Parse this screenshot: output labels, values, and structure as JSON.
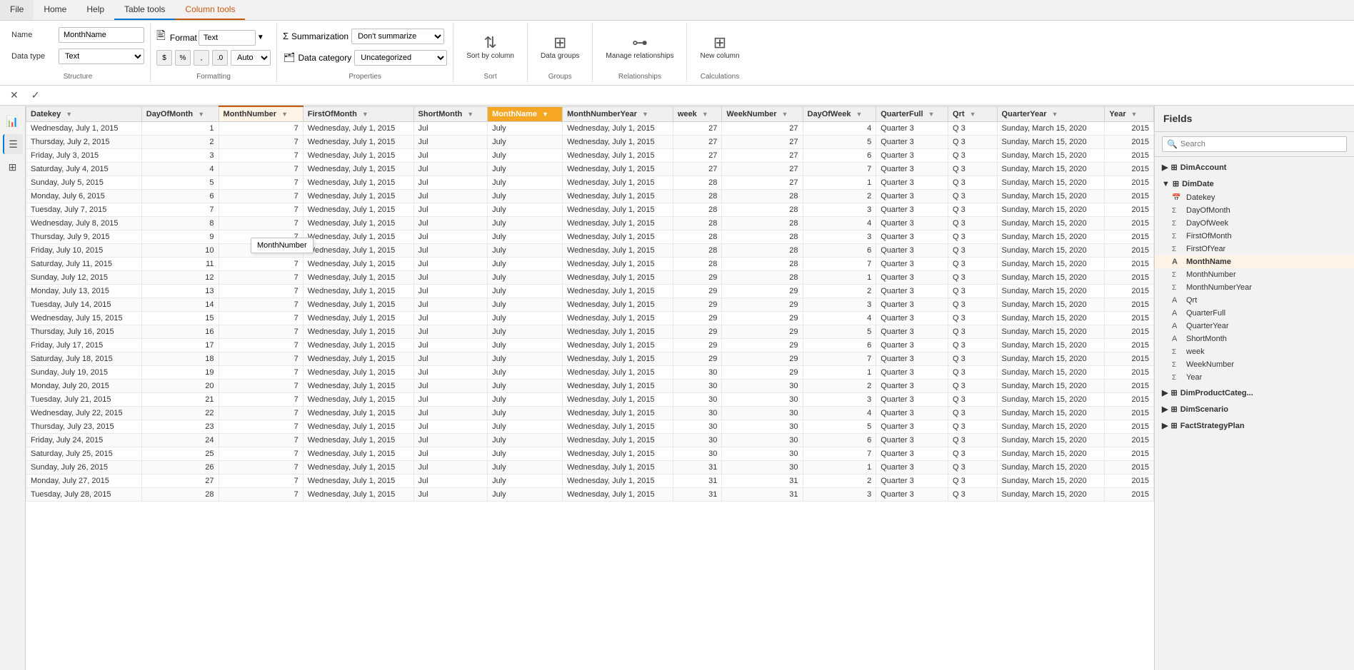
{
  "ribbon": {
    "tabs": [
      "File",
      "Home",
      "Help",
      "Table tools",
      "Column tools"
    ],
    "active_tab": "Column tools",
    "active_secondary": "Table tools",
    "structure_group": "Structure",
    "formatting_group": "Formatting",
    "properties_group": "Properties",
    "sort_group": "Sort",
    "groups_group": "Groups",
    "relationships_group": "Relationships",
    "calculations_group": "Calculations",
    "name_label": "Name",
    "name_value": "MonthName",
    "data_type_label": "Data type",
    "data_type_value": "Text",
    "format_label": "Format",
    "format_value": "Text",
    "summarization_label": "Summarization",
    "summarization_value": "Don't summarize",
    "data_category_label": "Data category",
    "data_category_value": "Uncategorized",
    "sort_by_column_label": "Sort by\ncolumn",
    "data_groups_label": "Data\ngroups",
    "manage_relationships_label": "Manage\nrelationships",
    "new_column_label": "New\ncolumn",
    "currency_symbol": "$",
    "percent_symbol": "%",
    "comma_symbol": ",",
    "decimal_symbol": ".0",
    "auto_label": "Auto"
  },
  "toolbar": {
    "close_label": "✕",
    "confirm_label": "✓"
  },
  "fields_panel": {
    "title": "Fields",
    "search_placeholder": "Search",
    "groups": [
      {
        "name": "DimAccount",
        "expanded": false,
        "icon": "table"
      },
      {
        "name": "DimDate",
        "expanded": true,
        "icon": "table",
        "fields": [
          {
            "name": "Datekey",
            "type": "calendar"
          },
          {
            "name": "DayOfMonth",
            "type": "sigma"
          },
          {
            "name": "DayOfWeek",
            "type": "sigma"
          },
          {
            "name": "FirstOfMonth",
            "type": "sigma"
          },
          {
            "name": "FirstOfYear",
            "type": "sigma"
          },
          {
            "name": "MonthName",
            "type": "text",
            "active": true
          },
          {
            "name": "MonthNumber",
            "type": "sigma"
          },
          {
            "name": "MonthNumberYear",
            "type": "sigma"
          },
          {
            "name": "Qrt",
            "type": "text"
          },
          {
            "name": "QuarterFull",
            "type": "text"
          },
          {
            "name": "QuarterYear",
            "type": "text"
          },
          {
            "name": "ShortMonth",
            "type": "text"
          },
          {
            "name": "week",
            "type": "sigma"
          },
          {
            "name": "WeekNumber",
            "type": "sigma"
          },
          {
            "name": "Year",
            "type": "sigma"
          }
        ]
      },
      {
        "name": "DimProductCateg...",
        "expanded": false,
        "icon": "table"
      },
      {
        "name": "DimScenario",
        "expanded": false,
        "icon": "table"
      },
      {
        "name": "FactStrategyPlan",
        "expanded": false,
        "icon": "table"
      }
    ]
  },
  "table": {
    "columns": [
      "Datekey",
      "DayOfMonth",
      "MonthNumber",
      "FirstOfMonth",
      "ShortMonth",
      "MonthName",
      "MonthNumberYear",
      "week",
      "WeekNumber",
      "DayOfWeek",
      "QuarterFull",
      "Qrt",
      "QuarterYear",
      "Year"
    ],
    "active_column": "MonthNumber",
    "highlighted_column": "MonthName",
    "rows": [
      [
        "Wednesday, July 1, 2015",
        "1",
        "7",
        "Wednesday, July 1, 2015",
        "Jul",
        "July",
        "Wednesday, July 1, 2015",
        "27",
        "27",
        "4",
        "Quarter 3",
        "Q 3",
        "Sunday, March 15, 2020",
        "2015"
      ],
      [
        "Thursday, July 2, 2015",
        "2",
        "7",
        "Wednesday, July 1, 2015",
        "Jul",
        "July",
        "Wednesday, July 1, 2015",
        "27",
        "27",
        "5",
        "Quarter 3",
        "Q 3",
        "Sunday, March 15, 2020",
        "2015"
      ],
      [
        "Friday, July 3, 2015",
        "3",
        "7",
        "Wednesday, July 1, 2015",
        "Jul",
        "July",
        "Wednesday, July 1, 2015",
        "27",
        "27",
        "6",
        "Quarter 3",
        "Q 3",
        "Sunday, March 15, 2020",
        "2015"
      ],
      [
        "Saturday, July 4, 2015",
        "4",
        "7",
        "Wednesday, July 1, 2015",
        "Jul",
        "July",
        "Wednesday, July 1, 2015",
        "27",
        "27",
        "7",
        "Quarter 3",
        "Q 3",
        "Sunday, March 15, 2020",
        "2015"
      ],
      [
        "Sunday, July 5, 2015",
        "5",
        "7",
        "Wednesday, July 1, 2015",
        "Jul",
        "July",
        "Wednesday, July 1, 2015",
        "28",
        "27",
        "1",
        "Quarter 3",
        "Q 3",
        "Sunday, March 15, 2020",
        "2015"
      ],
      [
        "Monday, July 6, 2015",
        "6",
        "7",
        "Wednesday, July 1, 2015",
        "Jul",
        "July",
        "Wednesday, July 1, 2015",
        "28",
        "28",
        "2",
        "Quarter 3",
        "Q 3",
        "Sunday, March 15, 2020",
        "2015"
      ],
      [
        "Tuesday, July 7, 2015",
        "7",
        "7",
        "Wednesday, July 1, 2015",
        "Jul",
        "July",
        "Wednesday, July 1, 2015",
        "28",
        "28",
        "3",
        "Quarter 3",
        "Q 3",
        "Sunday, March 15, 2020",
        "2015"
      ],
      [
        "Wednesday, July 8, 2015",
        "8",
        "7",
        "Wednesday, July 1, 2015",
        "Jul",
        "July",
        "Wednesday, July 1, 2015",
        "28",
        "28",
        "4",
        "Quarter 3",
        "Q 3",
        "Sunday, March 15, 2020",
        "2015"
      ],
      [
        "Thursday, July 9, 2015",
        "9",
        "7",
        "Wednesday, July 1, 2015",
        "Jul",
        "July",
        "Wednesday, July 1, 2015",
        "28",
        "28",
        "3",
        "Quarter 3",
        "Q 3",
        "Sunday, March 15, 2020",
        "2015"
      ],
      [
        "Friday, July 10, 2015",
        "10",
        "7",
        "Wednesday, July 1, 2015",
        "Jul",
        "July",
        "Wednesday, July 1, 2015",
        "28",
        "28",
        "6",
        "Quarter 3",
        "Q 3",
        "Sunday, March 15, 2020",
        "2015"
      ],
      [
        "Saturday, July 11, 2015",
        "11",
        "7",
        "Wednesday, July 1, 2015",
        "Jul",
        "July",
        "Wednesday, July 1, 2015",
        "28",
        "28",
        "7",
        "Quarter 3",
        "Q 3",
        "Sunday, March 15, 2020",
        "2015"
      ],
      [
        "Sunday, July 12, 2015",
        "12",
        "7",
        "Wednesday, July 1, 2015",
        "Jul",
        "July",
        "Wednesday, July 1, 2015",
        "29",
        "28",
        "1",
        "Quarter 3",
        "Q 3",
        "Sunday, March 15, 2020",
        "2015"
      ],
      [
        "Monday, July 13, 2015",
        "13",
        "7",
        "Wednesday, July 1, 2015",
        "Jul",
        "July",
        "Wednesday, July 1, 2015",
        "29",
        "29",
        "2",
        "Quarter 3",
        "Q 3",
        "Sunday, March 15, 2020",
        "2015"
      ],
      [
        "Tuesday, July 14, 2015",
        "14",
        "7",
        "Wednesday, July 1, 2015",
        "Jul",
        "July",
        "Wednesday, July 1, 2015",
        "29",
        "29",
        "3",
        "Quarter 3",
        "Q 3",
        "Sunday, March 15, 2020",
        "2015"
      ],
      [
        "Wednesday, July 15, 2015",
        "15",
        "7",
        "Wednesday, July 1, 2015",
        "Jul",
        "July",
        "Wednesday, July 1, 2015",
        "29",
        "29",
        "4",
        "Quarter 3",
        "Q 3",
        "Sunday, March 15, 2020",
        "2015"
      ],
      [
        "Thursday, July 16, 2015",
        "16",
        "7",
        "Wednesday, July 1, 2015",
        "Jul",
        "July",
        "Wednesday, July 1, 2015",
        "29",
        "29",
        "5",
        "Quarter 3",
        "Q 3",
        "Sunday, March 15, 2020",
        "2015"
      ],
      [
        "Friday, July 17, 2015",
        "17",
        "7",
        "Wednesday, July 1, 2015",
        "Jul",
        "July",
        "Wednesday, July 1, 2015",
        "29",
        "29",
        "6",
        "Quarter 3",
        "Q 3",
        "Sunday, March 15, 2020",
        "2015"
      ],
      [
        "Saturday, July 18, 2015",
        "18",
        "7",
        "Wednesday, July 1, 2015",
        "Jul",
        "July",
        "Wednesday, July 1, 2015",
        "29",
        "29",
        "7",
        "Quarter 3",
        "Q 3",
        "Sunday, March 15, 2020",
        "2015"
      ],
      [
        "Sunday, July 19, 2015",
        "19",
        "7",
        "Wednesday, July 1, 2015",
        "Jul",
        "July",
        "Wednesday, July 1, 2015",
        "30",
        "29",
        "1",
        "Quarter 3",
        "Q 3",
        "Sunday, March 15, 2020",
        "2015"
      ],
      [
        "Monday, July 20, 2015",
        "20",
        "7",
        "Wednesday, July 1, 2015",
        "Jul",
        "July",
        "Wednesday, July 1, 2015",
        "30",
        "30",
        "2",
        "Quarter 3",
        "Q 3",
        "Sunday, March 15, 2020",
        "2015"
      ],
      [
        "Tuesday, July 21, 2015",
        "21",
        "7",
        "Wednesday, July 1, 2015",
        "Jul",
        "July",
        "Wednesday, July 1, 2015",
        "30",
        "30",
        "3",
        "Quarter 3",
        "Q 3",
        "Sunday, March 15, 2020",
        "2015"
      ],
      [
        "Wednesday, July 22, 2015",
        "22",
        "7",
        "Wednesday, July 1, 2015",
        "Jul",
        "July",
        "Wednesday, July 1, 2015",
        "30",
        "30",
        "4",
        "Quarter 3",
        "Q 3",
        "Sunday, March 15, 2020",
        "2015"
      ],
      [
        "Thursday, July 23, 2015",
        "23",
        "7",
        "Wednesday, July 1, 2015",
        "Jul",
        "July",
        "Wednesday, July 1, 2015",
        "30",
        "30",
        "5",
        "Quarter 3",
        "Q 3",
        "Sunday, March 15, 2020",
        "2015"
      ],
      [
        "Friday, July 24, 2015",
        "24",
        "7",
        "Wednesday, July 1, 2015",
        "Jul",
        "July",
        "Wednesday, July 1, 2015",
        "30",
        "30",
        "6",
        "Quarter 3",
        "Q 3",
        "Sunday, March 15, 2020",
        "2015"
      ],
      [
        "Saturday, July 25, 2015",
        "25",
        "7",
        "Wednesday, July 1, 2015",
        "Jul",
        "July",
        "Wednesday, July 1, 2015",
        "30",
        "30",
        "7",
        "Quarter 3",
        "Q 3",
        "Sunday, March 15, 2020",
        "2015"
      ],
      [
        "Sunday, July 26, 2015",
        "26",
        "7",
        "Wednesday, July 1, 2015",
        "Jul",
        "July",
        "Wednesday, July 1, 2015",
        "31",
        "30",
        "1",
        "Quarter 3",
        "Q 3",
        "Sunday, March 15, 2020",
        "2015"
      ],
      [
        "Monday, July 27, 2015",
        "27",
        "7",
        "Wednesday, July 1, 2015",
        "Jul",
        "July",
        "Wednesday, July 1, 2015",
        "31",
        "31",
        "2",
        "Quarter 3",
        "Q 3",
        "Sunday, March 15, 2020",
        "2015"
      ],
      [
        "Tuesday, July 28, 2015",
        "28",
        "7",
        "Wednesday, July 1, 2015",
        "Jul",
        "July",
        "Wednesday, July 1, 2015",
        "31",
        "31",
        "3",
        "Quarter 3",
        "Q 3",
        "Sunday, March 15, 2020",
        "2015"
      ]
    ]
  },
  "tooltip": {
    "text": "MonthNumber"
  }
}
